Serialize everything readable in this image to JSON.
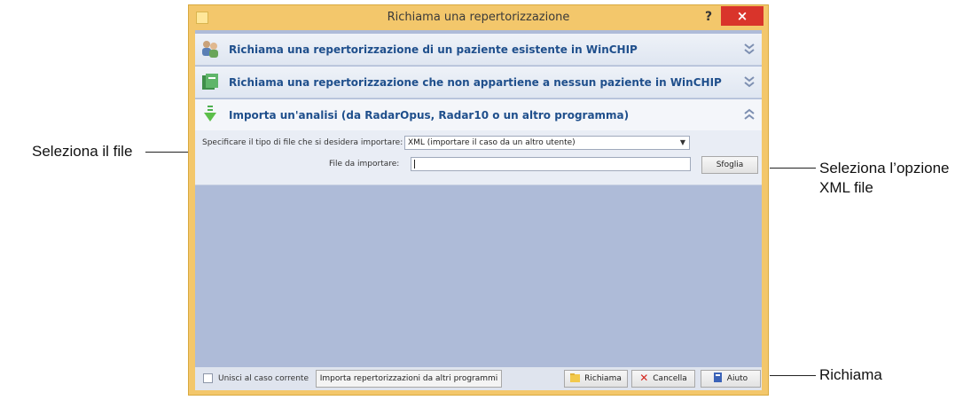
{
  "annotations": {
    "select_file": "Seleziona il file",
    "select_option_line1": "Seleziona l’opzione",
    "select_option_line2": "XML file",
    "recall": "Richiama"
  },
  "window": {
    "title": "Richiama una repertorizzazione",
    "help_label": "?",
    "close_label": "×"
  },
  "sections": {
    "existing_patient": "Richiama una repertorizzazione di un paziente esistente in WinCHIP",
    "no_patient": "Richiama una repertorizzazione che non appartiene a nessun paziente in WinCHIP",
    "import": "Importa un'analisi (da RadarOpus, Radar10 o un altro programma)"
  },
  "import_panel": {
    "type_label": "Specificare il tipo di file che si desidera importare:",
    "type_value": "XML (importare il caso da un altro utente)",
    "file_label": "File da importare:",
    "file_value": "",
    "browse_label": "Sfoglia"
  },
  "footer": {
    "merge_label": "Unisci al caso corrente",
    "merge_checked": false,
    "import_other_label": "Importa repertorizzazioni da altri programmi",
    "recall_label": "Richiama",
    "cancel_label": "Cancella",
    "help_label": "Aiuto"
  },
  "colors": {
    "window_frame": "#f3c76b",
    "close_button": "#d9342b",
    "section_text": "#1f4f8c",
    "client_background": "#aebbd8"
  },
  "icons": {
    "section1": "patients-icon",
    "section2": "folder-icon",
    "section3": "import-arrow-icon",
    "collapsed": "double-chevron-down-icon",
    "expanded": "double-chevron-up-icon"
  }
}
